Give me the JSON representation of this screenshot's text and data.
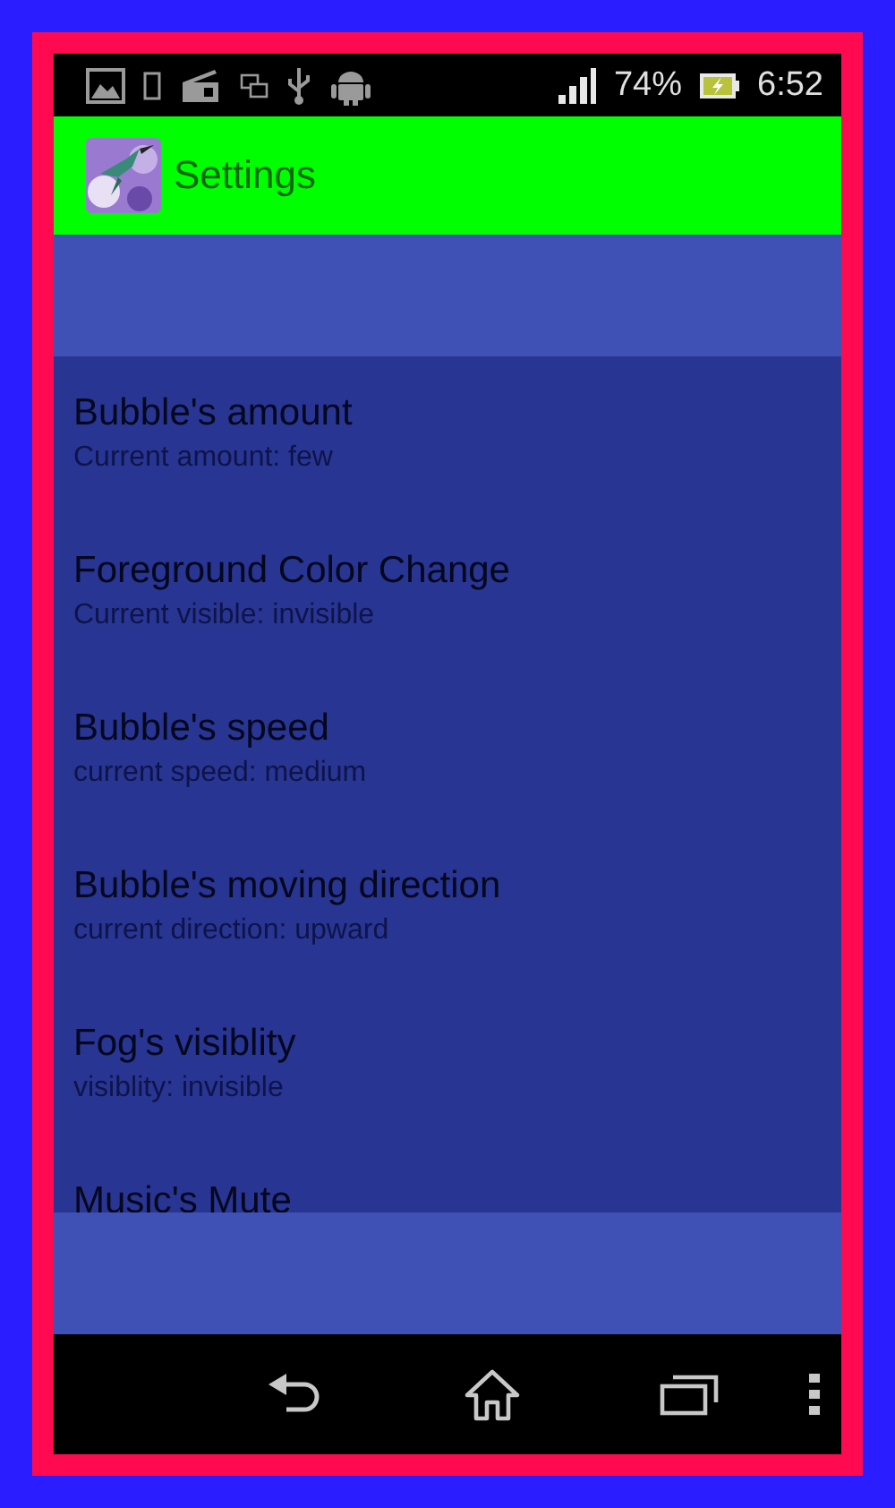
{
  "status_bar": {
    "battery": "74%",
    "time": "6:52"
  },
  "app_bar": {
    "title": "Settings"
  },
  "preferences": [
    {
      "title": "Bubble's amount",
      "summary": "Current amount: few"
    },
    {
      "title": "Foreground Color Change",
      "summary": "Current visible: invisible"
    },
    {
      "title": "Bubble's speed",
      "summary": "current speed: medium"
    },
    {
      "title": "Bubble's moving direction",
      "summary": "current direction: upward"
    },
    {
      "title": "Fog's visiblity",
      "summary": "visiblity: invisible"
    },
    {
      "title": "Music's Mute"
    }
  ]
}
